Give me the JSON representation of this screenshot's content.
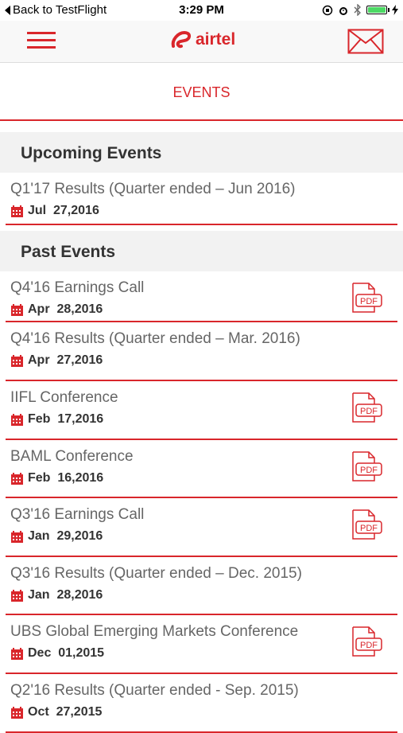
{
  "status_bar": {
    "back_label": "Back to TestFlight",
    "time": "3:29 PM"
  },
  "header": {
    "logo_text": "airtel"
  },
  "page_title": "EVENTS",
  "sections": {
    "upcoming": {
      "heading": "Upcoming Events"
    },
    "past": {
      "heading": "Past Events"
    }
  },
  "upcoming_events": [
    {
      "title": "Q1'17 Results (Quarter ended – Jun 2016)",
      "date": "Jul  27,2016",
      "has_pdf": false
    }
  ],
  "past_events": [
    {
      "title": "Q4'16 Earnings Call",
      "date": "Apr  28,2016",
      "has_pdf": true
    },
    {
      "title": "Q4'16 Results (Quarter ended – Mar. 2016)",
      "date": "Apr  27,2016",
      "has_pdf": false
    },
    {
      "title": "IIFL Conference",
      "date": "Feb  17,2016",
      "has_pdf": true
    },
    {
      "title": "BAML Conference",
      "date": "Feb  16,2016",
      "has_pdf": true
    },
    {
      "title": "Q3'16 Earnings Call",
      "date": "Jan  29,2016",
      "has_pdf": true
    },
    {
      "title": "Q3'16 Results (Quarter ended – Dec. 2015)",
      "date": "Jan  28,2016",
      "has_pdf": false
    },
    {
      "title": " UBS Global Emerging Markets Conference",
      "date": "Dec  01,2015",
      "has_pdf": true
    },
    {
      "title": "Q2'16 Results (Quarter ended - Sep. 2015)",
      "date": "Oct  27,2015",
      "has_pdf": false
    }
  ],
  "pdf_badge_label": "PDF",
  "colors": {
    "accent": "#d9262b",
    "battery": "#4cd964"
  },
  "icons": [
    "back-arrow-icon",
    "alarm-icon",
    "bluetooth-icon",
    "battery-icon",
    "hamburger-icon",
    "airtel-logo-icon",
    "mail-icon",
    "calendar-icon",
    "pdf-icon"
  ]
}
